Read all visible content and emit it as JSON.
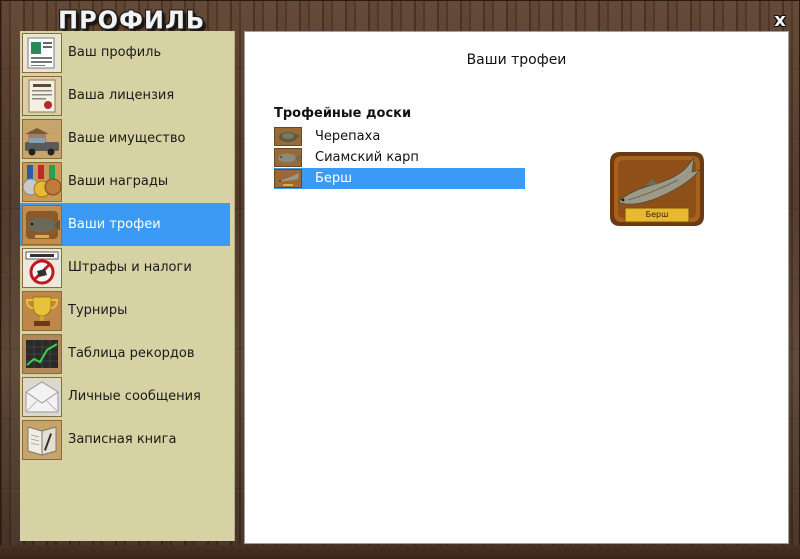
{
  "window": {
    "title": "ПРОФИЛЬ",
    "close_label": "x"
  },
  "sidebar": {
    "items": [
      {
        "label": "Ваш профиль",
        "icon": "profile-document-icon",
        "active": false
      },
      {
        "label": "Ваша лицензия",
        "icon": "license-certificate-icon",
        "active": false
      },
      {
        "label": "Ваше имущество",
        "icon": "property-vehicles-icon",
        "active": false
      },
      {
        "label": "Ваши награды",
        "icon": "medals-icon",
        "active": false
      },
      {
        "label": "Ваши трофеи",
        "icon": "fish-trophy-icon",
        "active": true
      },
      {
        "label": "Штрафы и налоги",
        "icon": "fine-sign-icon",
        "active": false
      },
      {
        "label": "Турниры",
        "icon": "tournament-cup-icon",
        "active": false
      },
      {
        "label": "Таблица рекордов",
        "icon": "records-chart-icon",
        "active": false
      },
      {
        "label": "Личные сообщения",
        "icon": "envelope-icon",
        "active": false
      },
      {
        "label": "Записная книга",
        "icon": "notebook-icon",
        "active": false
      }
    ]
  },
  "main": {
    "title": "Ваши трофеи",
    "section_title": "Трофейные доски",
    "trophies": [
      {
        "label": "Черепаха",
        "selected": false
      },
      {
        "label": "Сиамский карп",
        "selected": false
      },
      {
        "label": "Берш",
        "selected": true
      }
    ],
    "preview": {
      "plaque_label": "Берш"
    }
  },
  "colors": {
    "accent": "#3a9af6",
    "sidebar_bg": "#d7d2a4",
    "panel_bg": "#ffffff",
    "wood": "#4a3222"
  }
}
